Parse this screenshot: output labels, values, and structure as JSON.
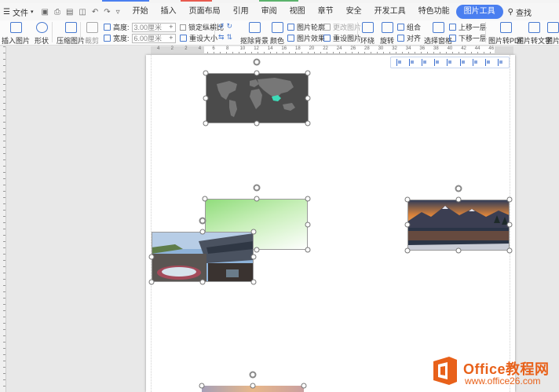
{
  "menubar": {
    "file_label": "文件",
    "tabs": [
      "开始",
      "插入",
      "页面布局",
      "引用",
      "审阅",
      "视图",
      "章节",
      "安全",
      "开发工具",
      "特色功能",
      "图片工具"
    ],
    "active_tab": "图片工具",
    "search_label": "查找"
  },
  "ribbon": {
    "insert_picture": "插入图片",
    "shape": "形状",
    "compress": "压缩图片",
    "crop": "裁剪",
    "height_label": "高度:",
    "height_value": "3.00厘米",
    "width_label": "宽度:",
    "width_value": "6.00厘米",
    "lock_ratio": "锁定纵横比",
    "reset_size": "重设大小",
    "clear_bg": "抠除背景",
    "color": "颜色",
    "picture_outline": "图片轮廓",
    "picture_effects": "图片效果",
    "change_picture": "更改图片",
    "reset_picture": "重设图片",
    "wrap": "环绕",
    "rotate": "旋转",
    "group": "组合",
    "align": "对齐",
    "selection_pane": "选择窗格",
    "bring_forward": "上移一层",
    "send_backward": "下移一层",
    "to_pdf": "图片转PDF",
    "to_text": "图片转文字",
    "picture_more": "图片"
  },
  "ruler": {
    "labels": [
      "4",
      "2",
      "2",
      "4",
      "6",
      "8",
      "10",
      "12",
      "14",
      "16",
      "18",
      "20",
      "22",
      "24",
      "26",
      "28",
      "30",
      "32",
      "34",
      "36",
      "38",
      "40",
      "42",
      "44",
      "46"
    ]
  },
  "watermark": {
    "brand": "Office教程网",
    "url": "www.office26.com"
  },
  "colors": {
    "accent": "#4a7ff0",
    "brand_orange": "#e8611a",
    "china_highlight": "#3ddbb8"
  }
}
